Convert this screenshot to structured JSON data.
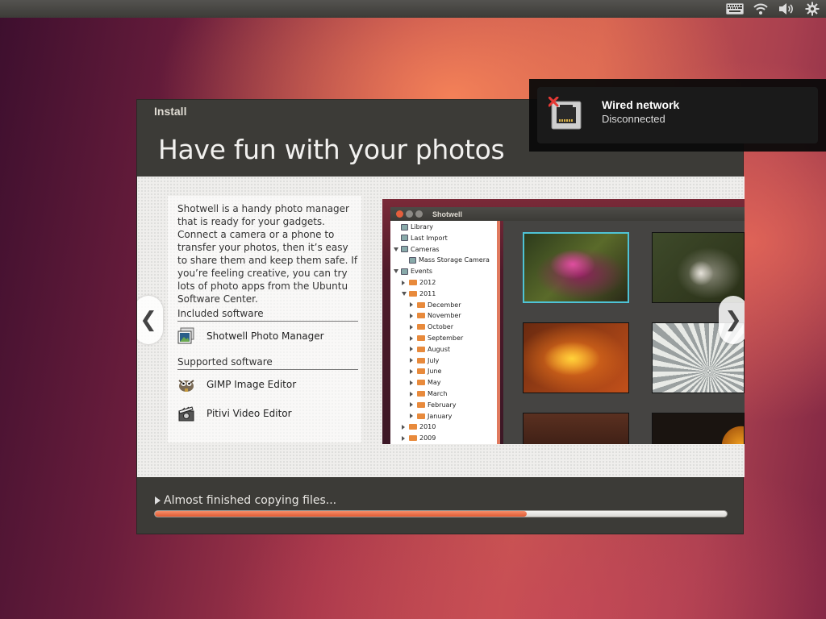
{
  "top_panel": {
    "icons": [
      "keyboard-icon",
      "wifi-icon",
      "volume-icon",
      "gear-icon"
    ]
  },
  "notification": {
    "title": "Wired network",
    "body": "Disconnected"
  },
  "installer": {
    "window_title": "Install",
    "slide_title": "Have fun with your photos",
    "description": "Shotwell is a handy photo manager that is ready for your gadgets. Connect a camera or a phone to transfer your photos, then it’s easy to share them and keep them safe. If you’re feeling creative, you can try lots of photo apps from the Ubuntu Software Center.",
    "included_heading": "Included software",
    "included": [
      {
        "label": "Shotwell Photo Manager",
        "icon": "shotwell-icon"
      }
    ],
    "supported_heading": "Supported software",
    "supported": [
      {
        "label": "GIMP Image Editor",
        "icon": "gimp-icon"
      },
      {
        "label": "Pitivi Video Editor",
        "icon": "pitivi-icon"
      }
    ],
    "prev_glyph": "❮",
    "next_glyph": "❯",
    "status_text": "Almost finished copying files...",
    "progress": 0.65
  },
  "shotwell_preview": {
    "title": "Shotwell",
    "sidebar": [
      {
        "label": "Library",
        "indent": 0,
        "kind": "icon"
      },
      {
        "label": "Last Import",
        "indent": 0,
        "kind": "icon"
      },
      {
        "label": "Cameras",
        "indent": 0,
        "kind": "expanded"
      },
      {
        "label": "Mass Storage Camera",
        "indent": 1,
        "kind": "icon"
      },
      {
        "label": "Events",
        "indent": 0,
        "kind": "expanded"
      },
      {
        "label": "2012",
        "indent": 1,
        "kind": "folder"
      },
      {
        "label": "2011",
        "indent": 1,
        "kind": "folder-open"
      },
      {
        "label": "December",
        "indent": 2,
        "kind": "folder"
      },
      {
        "label": "November",
        "indent": 2,
        "kind": "folder"
      },
      {
        "label": "October",
        "indent": 2,
        "kind": "folder"
      },
      {
        "label": "September",
        "indent": 2,
        "kind": "folder"
      },
      {
        "label": "August",
        "indent": 2,
        "kind": "folder"
      },
      {
        "label": "July",
        "indent": 2,
        "kind": "folder"
      },
      {
        "label": "June",
        "indent": 2,
        "kind": "folder"
      },
      {
        "label": "May",
        "indent": 2,
        "kind": "folder"
      },
      {
        "label": "March",
        "indent": 2,
        "kind": "folder"
      },
      {
        "label": "February",
        "indent": 2,
        "kind": "folder"
      },
      {
        "label": "January",
        "indent": 2,
        "kind": "folder"
      },
      {
        "label": "2010",
        "indent": 1,
        "kind": "folder"
      },
      {
        "label": "2009",
        "indent": 1,
        "kind": "folder"
      }
    ]
  },
  "colors": {
    "accent": "#e05a33",
    "panel": "#3c3b37",
    "selection": "#4ec3d6"
  }
}
